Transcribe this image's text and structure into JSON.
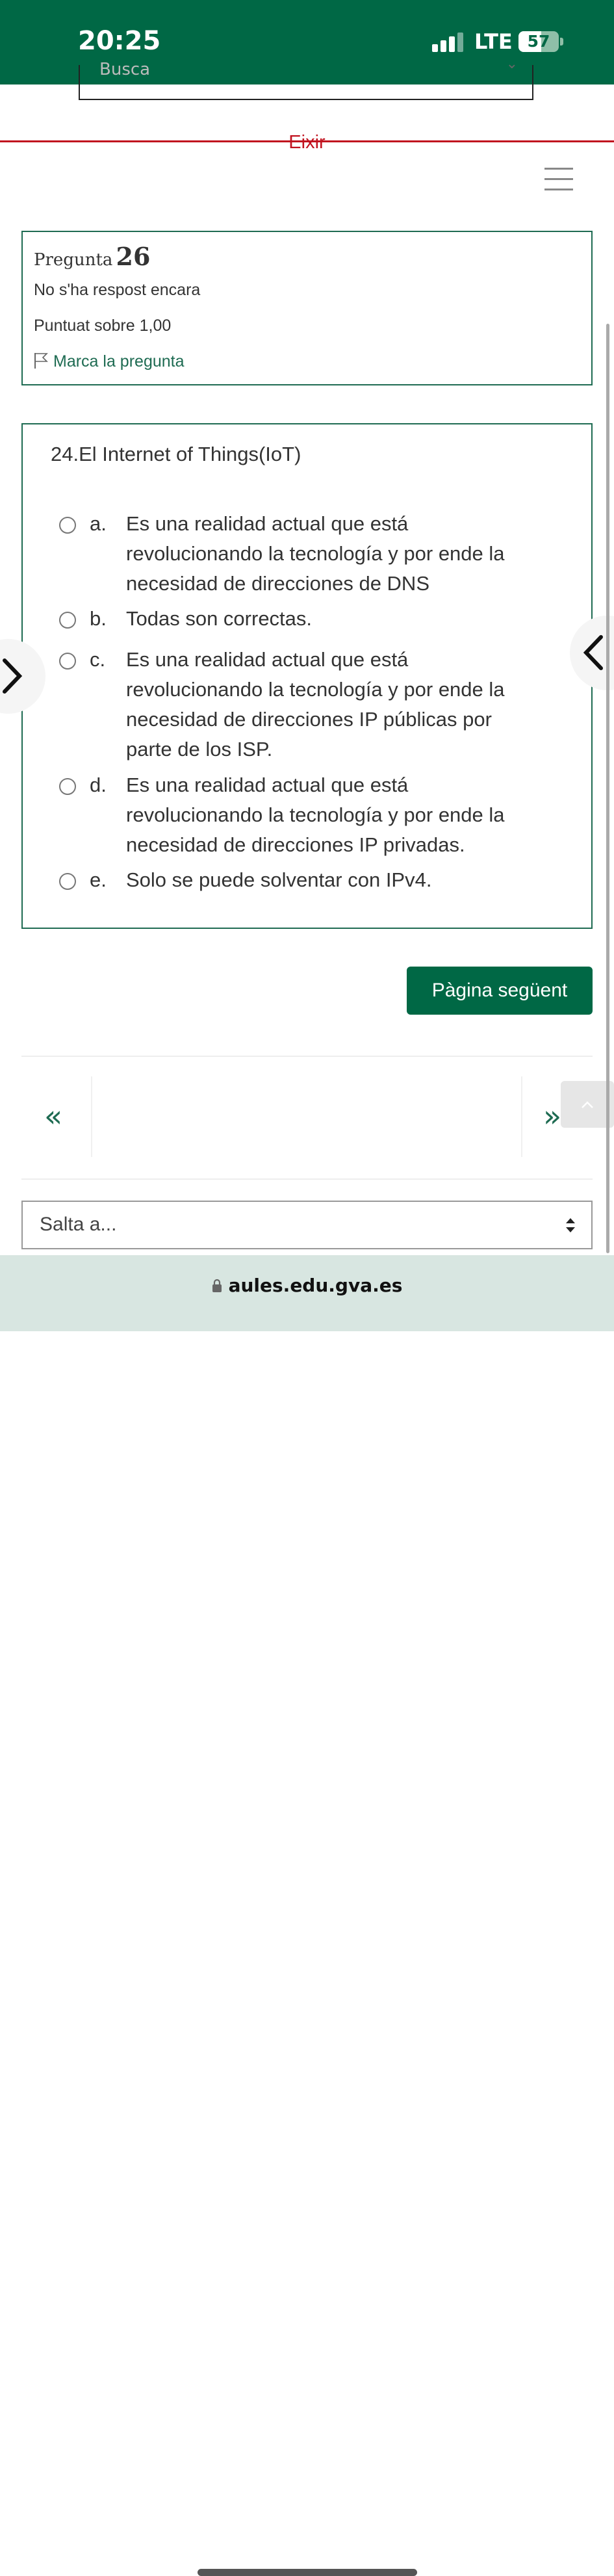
{
  "status_bar": {
    "time": "20:25",
    "network": "LTE",
    "battery_level": "57",
    "battery_fraction": 0.57
  },
  "header": {
    "search_placeholder": "Busca",
    "exit_label": "Eixir",
    "menu_icon": "hamburger-icon"
  },
  "question_info": {
    "label": "Pregunta",
    "number": "26",
    "status": "No s'ha respost encara",
    "score": "Puntuat sobre 1,00",
    "flag_label": "Marca la pregunta"
  },
  "question": {
    "text": "24.El Internet of Things(IoT)",
    "options": [
      {
        "letter": "a.",
        "text": "Es una realidad actual que está revolucionando la tecnología y por ende la necesidad de direcciones de DNS"
      },
      {
        "letter": "b.",
        "text": "Todas son correctas."
      },
      {
        "letter": "c.",
        "text": "Es una realidad actual que está revolucionando la tecnología y por ende la necesidad de direcciones IP públicas por parte de los ISP."
      },
      {
        "letter": "d.",
        "text": "Es una realidad actual que está revolucionando la tecnología y por ende la necesidad de direcciones IP privadas."
      },
      {
        "letter": "e.",
        "text": "Solo se puede solventar con IPv4."
      }
    ]
  },
  "next_button": "Pàgina següent",
  "navigation": {
    "prev_symbol": "«",
    "next_symbol": "»"
  },
  "jump_select": {
    "label": "Salta a..."
  },
  "browser": {
    "url": "aules.edu.gva.es"
  },
  "colors": {
    "primary_green": "#006845",
    "accent_red": "#c1121f",
    "url_bar_bg": "#d8e6e1"
  }
}
